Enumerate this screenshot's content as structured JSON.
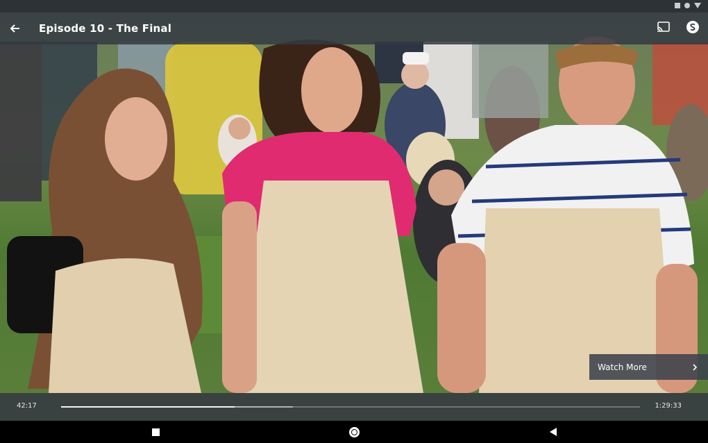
{
  "player": {
    "title": "Episode 10 - The Final",
    "watch_more_label": "Watch More",
    "elapsed": "42:17",
    "duration": "1:29:33",
    "progress_fraction": 0.3,
    "buffered_fraction": 0.4
  },
  "icons": {
    "back": "arrow-left-icon",
    "cast": "cast-icon",
    "logo": "channel-logo-icon",
    "watch_more_chevron": "chevron-right-icon",
    "nav_recents": "recents-square-icon",
    "nav_home": "home-circle-icon",
    "nav_back": "back-triangle-icon"
  },
  "colors": {
    "bar_bg": "#343a42",
    "text": "#ffffff",
    "progress": "#f2f3f4"
  }
}
